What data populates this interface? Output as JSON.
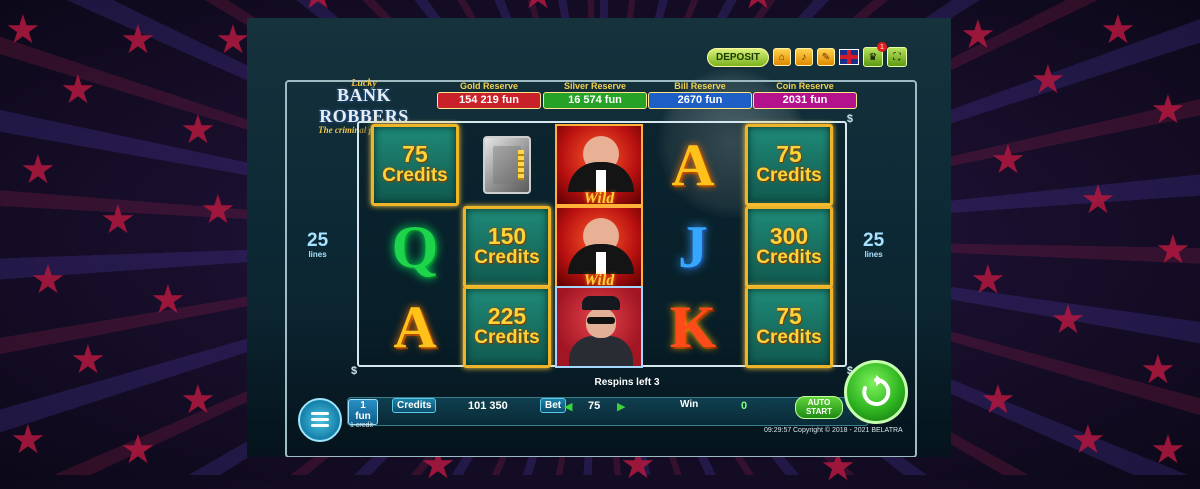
{
  "top_buttons": {
    "deposit": "DEPOSIT",
    "notification_count": "1"
  },
  "logo": {
    "lucky": "Lucky",
    "name": "BANK ROBBERS",
    "tagline": "The criminal police tales"
  },
  "reserves": [
    {
      "label": "Gold Reserve",
      "value": "154 219 fun",
      "color": "#c8212a"
    },
    {
      "label": "Silver Reserve",
      "value": "16 574 fun",
      "color": "#26a326"
    },
    {
      "label": "Bill Reserve",
      "value": "2670 fun",
      "color": "#1d5fc4"
    },
    {
      "label": "Coin Reserve",
      "value": "2031 fun",
      "color": "#b3128c"
    }
  ],
  "lines": {
    "count": "25",
    "label": "lines"
  },
  "reels": [
    [
      {
        "type": "credit",
        "num": "75",
        "word": "Credits"
      },
      {
        "type": "letter",
        "letter": "Q"
      },
      {
        "type": "letter",
        "letter": "A"
      }
    ],
    [
      {
        "type": "safe"
      },
      {
        "type": "credit",
        "num": "150",
        "word": "Credits"
      },
      {
        "type": "credit",
        "num": "225",
        "word": "Credits"
      }
    ],
    [
      {
        "type": "wild",
        "word": "Wild"
      },
      {
        "type": "wild",
        "word": "Wild"
      },
      {
        "type": "cop"
      }
    ],
    [
      {
        "type": "letter",
        "letter": "A"
      },
      {
        "type": "letter",
        "letter": "J"
      },
      {
        "type": "letter",
        "letter": "K"
      }
    ],
    [
      {
        "type": "credit",
        "num": "75",
        "word": "Credits"
      },
      {
        "type": "credit",
        "num": "300",
        "word": "Credits"
      },
      {
        "type": "credit",
        "num": "75",
        "word": "Credits"
      }
    ]
  ],
  "status": {
    "respins": "Respins left 3"
  },
  "bottom_bar": {
    "coin_value": "1",
    "coin_unit": "fun",
    "credits_label": "Credits",
    "credits_value": "101 350",
    "bet_label": "Bet",
    "bet_value": "75",
    "win_label": "Win",
    "win_value": "0",
    "auto_start_line1": "AUTO",
    "auto_start_line2": "START"
  },
  "footer": {
    "denomination": "1 credit",
    "time": "09:29:57",
    "copyright": "Copyright © 2018 - 2021 BELATRA"
  }
}
